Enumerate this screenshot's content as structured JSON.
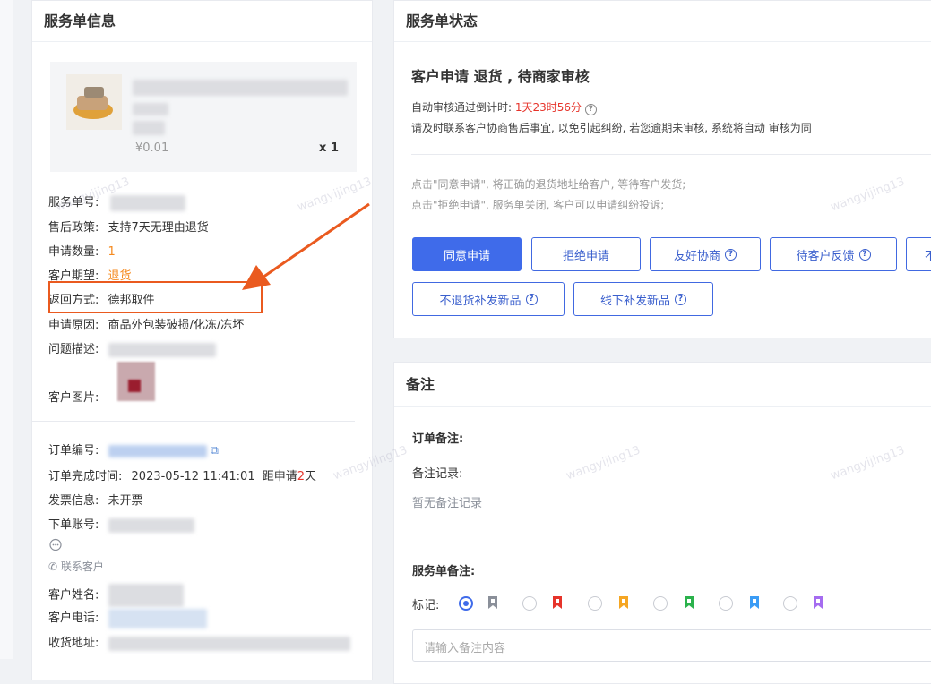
{
  "left": {
    "title": "服务单信息",
    "product": {
      "price": "¥0.01",
      "qty": "x 1"
    },
    "rows": {
      "service_no_label": "服务单号:",
      "policy_label": "售后政策:",
      "policy_value": "支持7天无理由退货",
      "quantity_label": "申请数量:",
      "quantity_value": "1",
      "expect_label": "客户期望:",
      "expect_value": "退货",
      "return_label": "返回方式:",
      "return_value": "德邦取件",
      "reason_label": "申请原因:",
      "reason_value": "商品外包装破损/化冻/冻坏",
      "problem_label": "问题描述:",
      "images_label": "客户图片:",
      "order_no_label": "订单编号:",
      "finish_label": "订单完成时间:",
      "finish_value": "2023-05-12 11:41:01",
      "distance_prefix": "距申请",
      "distance_days": "2",
      "distance_suffix": "天",
      "invoice_label": "发票信息:",
      "invoice_value": "未开票",
      "account_label": "下单账号:",
      "contact_label": "联系客户",
      "name_label": "客户姓名:",
      "phone_label": "客户电话:",
      "address_label": "收货地址:"
    }
  },
  "status": {
    "title": "服务单状态",
    "headline": "客户申请 退货 , 待商家审核",
    "countdown_label": "自动审核通过倒计时:",
    "countdown_value": "1天23时56分",
    "notice": "请及时联系客户协商售后事宜, 以免引起纠纷, 若您逾期未审核, 系统将自动 审核为同",
    "hint1": "点击\"同意申请\", 将正确的退货地址给客户, 等待客户发货;",
    "hint2": "点击\"拒绝申请\", 服务单关闭, 客户可以申请纠纷投诉;",
    "buttons": {
      "agree": "同意申请",
      "reject": "拒绝申请",
      "negotiate": "友好协商",
      "wait_feedback": "待客户反馈",
      "cut": "不",
      "no_return_reissue": "不退货补发新品",
      "offline_reissue": "线下补发新品"
    },
    "colors": {
      "primary": "#3f6bea",
      "countdown": "#e6332a",
      "highlight": "#ea5a1f"
    }
  },
  "notes": {
    "title": "备注",
    "order_note_label": "订单备注:",
    "record_label": "备注记录:",
    "record_empty": "暂无备注记录",
    "service_note_label": "服务单备注:",
    "mark_label": "标记:",
    "flag_colors": [
      "#8a8f99",
      "#e6332a",
      "#f5a623",
      "#2bb24c",
      "#3b9cf5",
      "#a56cf0"
    ],
    "input_placeholder": "请输入备注内容"
  },
  "watermark": "wangyijing13"
}
